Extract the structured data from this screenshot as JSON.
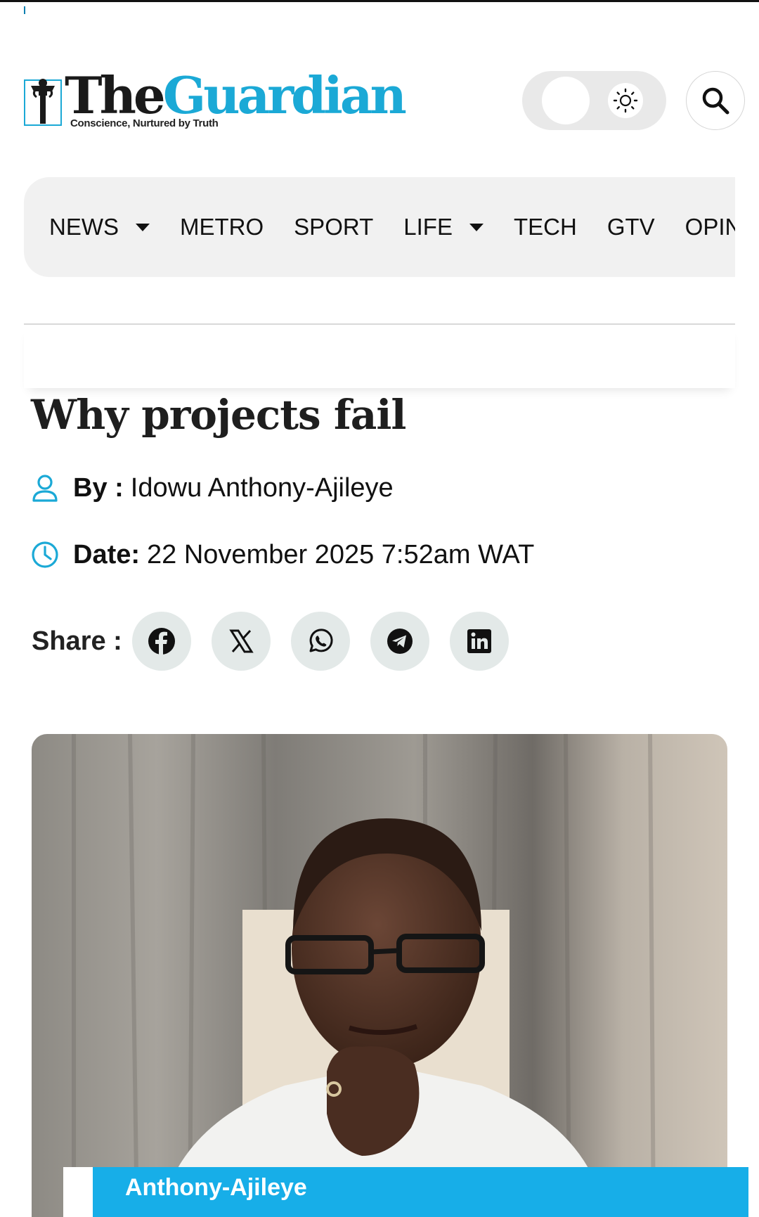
{
  "header": {
    "logo": {
      "word_1": "The",
      "word_2": "Guardian",
      "tagline": "Conscience, Nurtured by Truth"
    },
    "theme_toggle": {
      "icon": "sun-icon",
      "state": "light"
    },
    "search": {
      "icon": "search-icon"
    }
  },
  "nav": {
    "items": [
      {
        "label": "NEWS",
        "has_dropdown": true
      },
      {
        "label": "METRO",
        "has_dropdown": false
      },
      {
        "label": "SPORT",
        "has_dropdown": false
      },
      {
        "label": "LIFE",
        "has_dropdown": true
      },
      {
        "label": "TECH",
        "has_dropdown": false
      },
      {
        "label": "GTV",
        "has_dropdown": false
      },
      {
        "label": "OPINIC",
        "has_dropdown": false
      }
    ]
  },
  "article": {
    "title": "Why projects fail",
    "author_label": "By :",
    "author": "Idowu Anthony-Ajileye",
    "date_label": "Date:",
    "date": "22 November 2025 7:52am WAT",
    "share_label": "Share :",
    "share_buttons": [
      "facebook-icon",
      "x-icon",
      "whatsapp-icon",
      "telegram-icon",
      "linkedin-icon"
    ],
    "image_caption": "Anthony-Ajileye"
  },
  "colors": {
    "brand_blue": "#1ba9d6",
    "caption_blue": "#17aee8",
    "nav_bg": "#f1f1f1",
    "share_bg": "#e3e9e8"
  }
}
